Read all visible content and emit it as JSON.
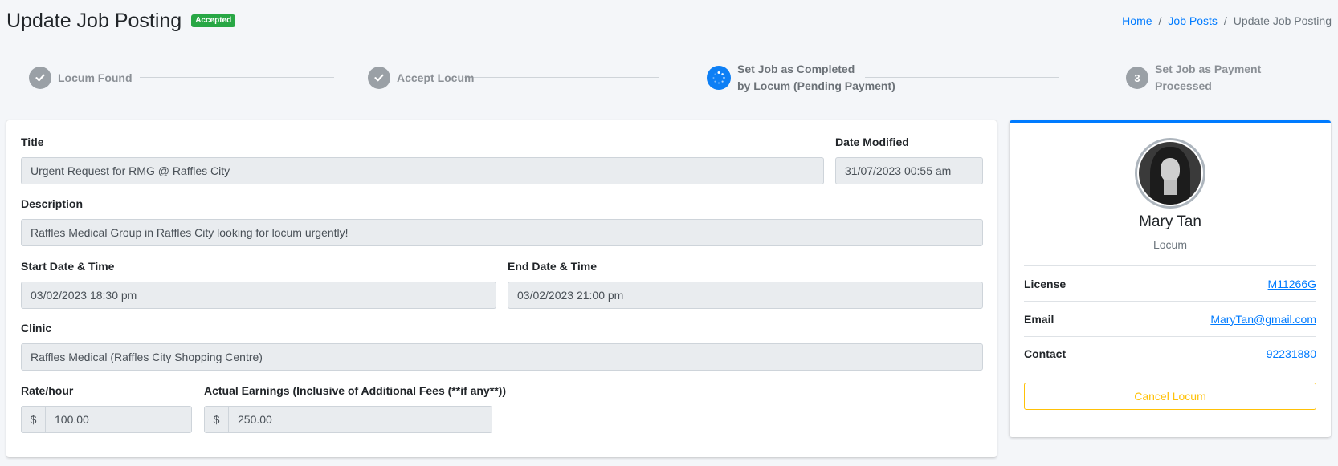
{
  "header": {
    "title": "Update Job Posting",
    "status_badge": "Accepted",
    "status_color": "#28a745"
  },
  "breadcrumb": {
    "items": [
      "Home",
      "Job Posts",
      "Update Job Posting"
    ],
    "separator": "/"
  },
  "stepper": {
    "steps": [
      {
        "label": "Locum Found",
        "state": "done",
        "icon": "check-icon"
      },
      {
        "label": "Accept Locum",
        "state": "done",
        "icon": "check-icon"
      },
      {
        "label_line1": "Set Job as Completed",
        "label_line2": "by Locum (Pending Payment)",
        "state": "active",
        "icon": "spinner-icon"
      },
      {
        "label": "Set Job as Payment Processed",
        "state": "pending",
        "number": "3"
      }
    ]
  },
  "form": {
    "title_label": "Title",
    "title_value": "Urgent Request for RMG @ Raffles City",
    "date_modified_label": "Date Modified",
    "date_modified_value": "31/07/2023 00:55 am",
    "description_label": "Description",
    "description_value": "Raffles Medical Group in Raffles City looking for locum urgently!",
    "start_label": "Start Date & Time",
    "start_value": "03/02/2023 18:30 pm",
    "end_label": "End Date & Time",
    "end_value": "03/02/2023 21:00 pm",
    "clinic_label": "Clinic",
    "clinic_value": "Raffles Medical (Raffles City Shopping Centre)",
    "rate_label": "Rate/hour",
    "rate_prefix": "$",
    "rate_value": "100.00",
    "earnings_label": "Actual Earnings (Inclusive of Additional Fees (**if any**))",
    "earnings_prefix": "$",
    "earnings_value": "250.00"
  },
  "profile": {
    "name": "Mary Tan",
    "role": "Locum",
    "license_label": "License",
    "license_value": "M11266G",
    "email_label": "Email",
    "email_value": "MaryTan@gmail.com",
    "contact_label": "Contact",
    "contact_value": "92231880",
    "cancel_label": "Cancel Locum"
  },
  "colors": {
    "accent": "#007bff",
    "warning": "#ffc107",
    "step_active": "#0d7ff5",
    "step_done": "#9aa0a6"
  }
}
